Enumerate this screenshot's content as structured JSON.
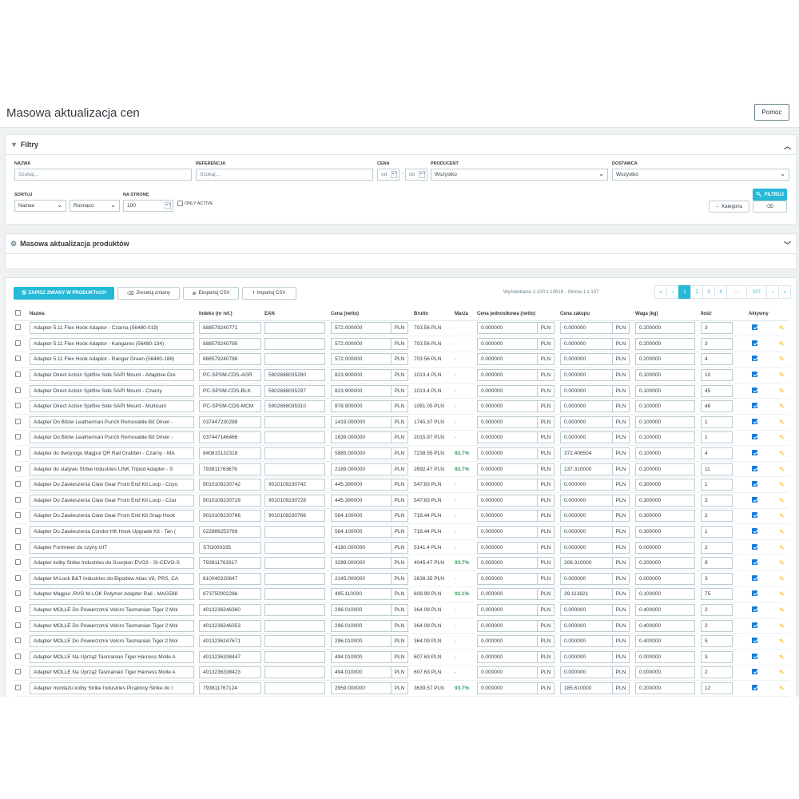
{
  "page": {
    "title": "Masowa aktualizacja cen",
    "help": "Pomoc"
  },
  "filters": {
    "title": "Filtry",
    "nazwa_label": "NAZWA",
    "nazwa_placeholder": "Szukaj...",
    "referencja_label": "REFERENCJA",
    "referencja_placeholder": "Szukaj...",
    "cena_label": "CENA",
    "cena_od": "od",
    "cena_do": "do",
    "producent_label": "PRODUCENT",
    "producent_value": "Wszystko",
    "dostawca_label": "DOSTAWCA",
    "dostawca_value": "Wszystko",
    "sortuj_label": "SORTUJ",
    "sortuj_value": "Nazwa",
    "order_value": "Rosnąco",
    "na_stronie_label": "NA STRONĘ",
    "na_stronie_value": "100",
    "only_active": "ONLY ACTIVE",
    "filter_btn": "FILTRUJ",
    "kategoria_btn": "Kategoria"
  },
  "bulk": {
    "title": "Masowa aktualizacja produktów"
  },
  "toolbar": {
    "save": "ZAPISZ ZMIANY W PRODUKTACH",
    "reset": "Zresetuj zmiany",
    "export": "Eksportuj CSV",
    "import": "Importuj CSV",
    "page_info": "Wyświetlanie 1-100 z 10618 - Strona 1 z 107",
    "pages": [
      "«",
      "‹",
      "1",
      "2",
      "3",
      "4",
      "...",
      "107",
      "›",
      "»"
    ]
  },
  "table": {
    "headers": [
      "Nazwa",
      "Indeks (nr ref.)",
      "EAN",
      "Cena (netto)",
      "Brutto",
      "Marża",
      "Cena jednostkowa (netto)",
      "Cena zakupu",
      "Waga (kg)",
      "Ilość",
      "Aktywny"
    ],
    "currency": "PLN",
    "rows": [
      {
        "name": "Adapter 5.11 Flex Hook Adaptor - Czarna (56480-019)",
        "ref": "888579240771",
        "ean": "",
        "net": "572.000000",
        "gross": "703.56 PLN",
        "margin": "-",
        "unit": "0.000000",
        "buy": "0.000000",
        "weight": "0.200000",
        "qty": "3"
      },
      {
        "name": "Adapter 5.11 Flex Hook Adaptor - Kangaroo (56480-134)",
        "ref": "888579240795",
        "ean": "",
        "net": "572.000000",
        "gross": "703.56 PLN",
        "margin": "-",
        "unit": "0.000000",
        "buy": "0.000000",
        "weight": "0.200000",
        "qty": "3"
      },
      {
        "name": "Adapter 5.11 Flex Hook Adaptor - Ranger Green (56480-188)",
        "ref": "888579240788",
        "ean": "",
        "net": "572.000000",
        "gross": "703.56 PLN",
        "margin": "-",
        "unit": "0.000000",
        "buy": "0.000000",
        "weight": "0.200000",
        "qty": "4"
      },
      {
        "name": "Adapter Direct Action Spitfire Side SAPI Mount - Adaptive Gre",
        "ref": "PC-SPSM-CDS-AGR",
        "ean": "5902688035280",
        "net": "823.900000",
        "gross": "1013.4 PLN",
        "margin": "-",
        "unit": "0.000000",
        "buy": "0.000000",
        "weight": "0.100000",
        "qty": "10"
      },
      {
        "name": "Adapter Direct Action Spitfire Side SAPI Mount - Czarny",
        "ref": "PC-SPSM-CDS-BLK",
        "ean": "5902688035297",
        "net": "823.900000",
        "gross": "1013.4 PLN",
        "margin": "-",
        "unit": "0.000000",
        "buy": "0.000000",
        "weight": "0.100000",
        "qty": "45"
      },
      {
        "name": "Adapter Direct Action Spitfire Side SAPI Mount - Multicam",
        "ref": "PC-SPSM-CDS-MCM",
        "ean": "5902688035310",
        "net": "878.900000",
        "gross": "1081.05 PLN",
        "margin": "-",
        "unit": "0.000000",
        "buy": "0.000000",
        "weight": "0.100000",
        "qty": "46"
      },
      {
        "name": "Adapter Do Bitów Leatherman Punch Removable Bit Driver -",
        "ref": "037447230288",
        "ean": "",
        "net": "1419.000000",
        "gross": "1745.37 PLN",
        "margin": "-",
        "unit": "0.000000",
        "buy": "0.000000",
        "weight": "0.100000",
        "qty": "1"
      },
      {
        "name": "Adapter Do Bitów Leatherman Punch Removable Bit Driver -",
        "ref": "037447146466",
        "ean": "",
        "net": "1639.000000",
        "gross": "2015.97 PLN",
        "margin": "-",
        "unit": "0.000000",
        "buy": "0.000000",
        "weight": "0.100000",
        "qty": "1"
      },
      {
        "name": "Adapter do dwójnogu Magpul QR Rail Grabber - Czarny - MA",
        "ref": "840815132318",
        "ean": "",
        "net": "5885.000000",
        "gross": "7238.55 PLN",
        "margin": "93.7%",
        "unit": "0.000000",
        "buy": "372.406504",
        "weight": "0.100000",
        "qty": "4"
      },
      {
        "name": "Adapter do statywu Strike Industries LINK Tripod Adapter - S",
        "ref": "793811763676",
        "ean": "",
        "net": "2189.000000",
        "gross": "2692.47 PLN",
        "margin": "93.7%",
        "unit": "0.000000",
        "buy": "137.310000",
        "weight": "0.200000",
        "qty": "11"
      },
      {
        "name": "Adapter Do Zawieszenia Claw Gear Front End Kit Loop - Coyo",
        "ref": "9010109230742",
        "ean": "9010109230742",
        "net": "445.390000",
        "gross": "547.83 PLN",
        "margin": "-",
        "unit": "0.000000",
        "buy": "0.000000",
        "weight": "0.300000",
        "qty": "1"
      },
      {
        "name": "Adapter Do Zawieszenia Claw Gear Front End Kit Loop - Czar",
        "ref": "9010109230728",
        "ean": "9010109230728",
        "net": "445.390000",
        "gross": "547.83 PLN",
        "margin": "-",
        "unit": "0.000000",
        "buy": "0.000000",
        "weight": "0.300000",
        "qty": "3"
      },
      {
        "name": "Adapter Do Zawieszenia Claw Gear Front End Kit Snap Hook",
        "ref": "9010109230766",
        "ean": "9010109230766",
        "net": "584.100000",
        "gross": "718.44 PLN",
        "margin": "-",
        "unit": "0.000000",
        "buy": "0.000000",
        "weight": "0.300000",
        "qty": "2"
      },
      {
        "name": "Adapter Do Zawieszenia Condor HK Hook Upgrade Kit - Tan (",
        "ref": "022886253769",
        "ean": "",
        "net": "584.100000",
        "gross": "718.44 PLN",
        "margin": "-",
        "unit": "0.000000",
        "buy": "0.000000",
        "weight": "0.300000",
        "qty": "1"
      },
      {
        "name": "Adapter Fortmeier do szyny UIT",
        "ref": "STO000335",
        "ean": "",
        "net": "4180.000000",
        "gross": "5141.4 PLN",
        "margin": "-",
        "unit": "0.000000",
        "buy": "0.000000",
        "weight": "0.000000",
        "qty": "2"
      },
      {
        "name": "Adapter kolby Strike Industries do Scorpion EVO3 - SI-CEVO-S",
        "ref": "793811763317",
        "ean": "",
        "net": "3289.000000",
        "gross": "4045.47 PLN",
        "margin": "93.7%",
        "unit": "0.000000",
        "buy": "206.310000",
        "weight": "0.200000",
        "qty": "8"
      },
      {
        "name": "Adapter M-Lock B&T Industries do Bipodów Atlas V8, PRS, CA",
        "ref": "810040220647",
        "ean": "",
        "net": "2145.000000",
        "gross": "2638.35 PLN",
        "margin": "-",
        "unit": "0.000000",
        "buy": "0.000000",
        "weight": "0.000000",
        "qty": "3"
      },
      {
        "name": "Adapter Magpul .RVG M-LOK Polymer Adapter Rail - MAG598",
        "ref": "873750002286",
        "ean": "",
        "net": "495.110000",
        "gross": "608.99 PLN",
        "margin": "92.1%",
        "unit": "0.000000",
        "buy": "39.113821",
        "weight": "0.100000",
        "qty": "75"
      },
      {
        "name": "Adapter MOLLE Do Powierzchni Velcro Tasmanian Tiger 2 Mol",
        "ref": "4013236246360",
        "ean": "",
        "net": "296.010000",
        "gross": "364.09 PLN",
        "margin": "-",
        "unit": "0.000000",
        "buy": "0.000000",
        "weight": "0.400000",
        "qty": "2"
      },
      {
        "name": "Adapter MOLLE Do Powierzchni Velcro Tasmanian Tiger 2 Mol",
        "ref": "4013236246353",
        "ean": "",
        "net": "296.010000",
        "gross": "364.09 PLN",
        "margin": "-",
        "unit": "0.000000",
        "buy": "0.000000",
        "weight": "0.400000",
        "qty": "2"
      },
      {
        "name": "Adapter MOLLE Do Powierzchni Velcro Tasmanian Tiger 2 Mol",
        "ref": "4013236247671",
        "ean": "",
        "net": "296.010000",
        "gross": "364.09 PLN",
        "margin": "-",
        "unit": "0.000000",
        "buy": "0.000000",
        "weight": "0.400000",
        "qty": "5"
      },
      {
        "name": "Adapter MOLLE Na Uprząż Tasmanian Tiger Harness Molle A",
        "ref": "4013236338447",
        "ean": "",
        "net": "494.010000",
        "gross": "607.63 PLN",
        "margin": "-",
        "unit": "0.000000",
        "buy": "0.000000",
        "weight": "0.000000",
        "qty": "3"
      },
      {
        "name": "Adapter MOLLE Na Uprząż Tasmanian Tiger Harness Molle A",
        "ref": "4013236338423",
        "ean": "",
        "net": "494.010000",
        "gross": "607.63 PLN",
        "margin": "-",
        "unit": "0.000000",
        "buy": "0.000000",
        "weight": "0.000000",
        "qty": "2"
      },
      {
        "name": "Adapter montażu kolby Strike Industries Picatinny Strike do I",
        "ref": "793811767124",
        "ean": "",
        "net": "2959.000000",
        "gross": "3639.57 PLN",
        "margin": "93.7%",
        "unit": "0.000000",
        "buy": "185.610000",
        "weight": "0.200000",
        "qty": "12"
      }
    ]
  }
}
